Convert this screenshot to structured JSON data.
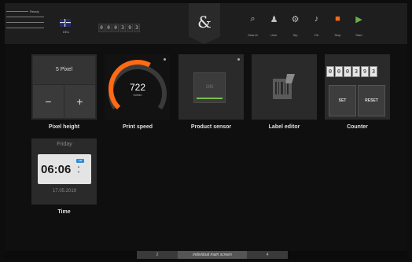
{
  "header": {
    "status": {
      "ready_label": "Ready"
    },
    "language": {
      "code": "DEU",
      "flag_icon": "uk-flag-icon"
    },
    "top_counter_digits": [
      "0",
      "0",
      "0",
      "3",
      "9",
      "3"
    ],
    "logo_glyph": "&",
    "toolbar": [
      {
        "name": "search",
        "label": "Search",
        "icon": "search-icon",
        "glyph": "⌕"
      },
      {
        "name": "user",
        "label": "User",
        "icon": "user-icon",
        "glyph": "♟"
      },
      {
        "name": "setup",
        "label": "Stp",
        "icon": "gear-icon",
        "glyph": "⚙"
      },
      {
        "name": "ok",
        "label": "OK",
        "icon": "bell-icon",
        "glyph": "♪"
      },
      {
        "name": "stop",
        "label": "Stop",
        "icon": "stop-icon",
        "glyph": "■"
      },
      {
        "name": "start",
        "label": "Start",
        "icon": "play-icon",
        "glyph": "▶"
      }
    ]
  },
  "tiles": {
    "pixel_height": {
      "value": "5 Pixel",
      "minus": "−",
      "plus": "+",
      "label": "Pixel height"
    },
    "print_speed": {
      "value": "722",
      "unit": "m/min",
      "label": "Print speed",
      "level_fraction": 0.6
    },
    "product_sensor": {
      "state": "ON",
      "label": "Product sensor"
    },
    "label_editor": {
      "label": "Label editor",
      "icon": "barcode-edit-icon"
    },
    "counter": {
      "digits": [
        "0",
        "0",
        "0",
        "3",
        "9",
        "3"
      ],
      "set": "SET",
      "reset": "RESET",
      "label": "Counter"
    },
    "time": {
      "day": "Friday",
      "time": "06:06",
      "ampm": "AM",
      "date": "17.05.2019",
      "label": "Time"
    }
  },
  "footer": {
    "prev": "2",
    "current": "individual main screen",
    "next": "4"
  },
  "colors": {
    "accent_orange": "#ff6a13",
    "accent_green": "#7ac04f",
    "accent_blue": "#2e8bd8"
  }
}
